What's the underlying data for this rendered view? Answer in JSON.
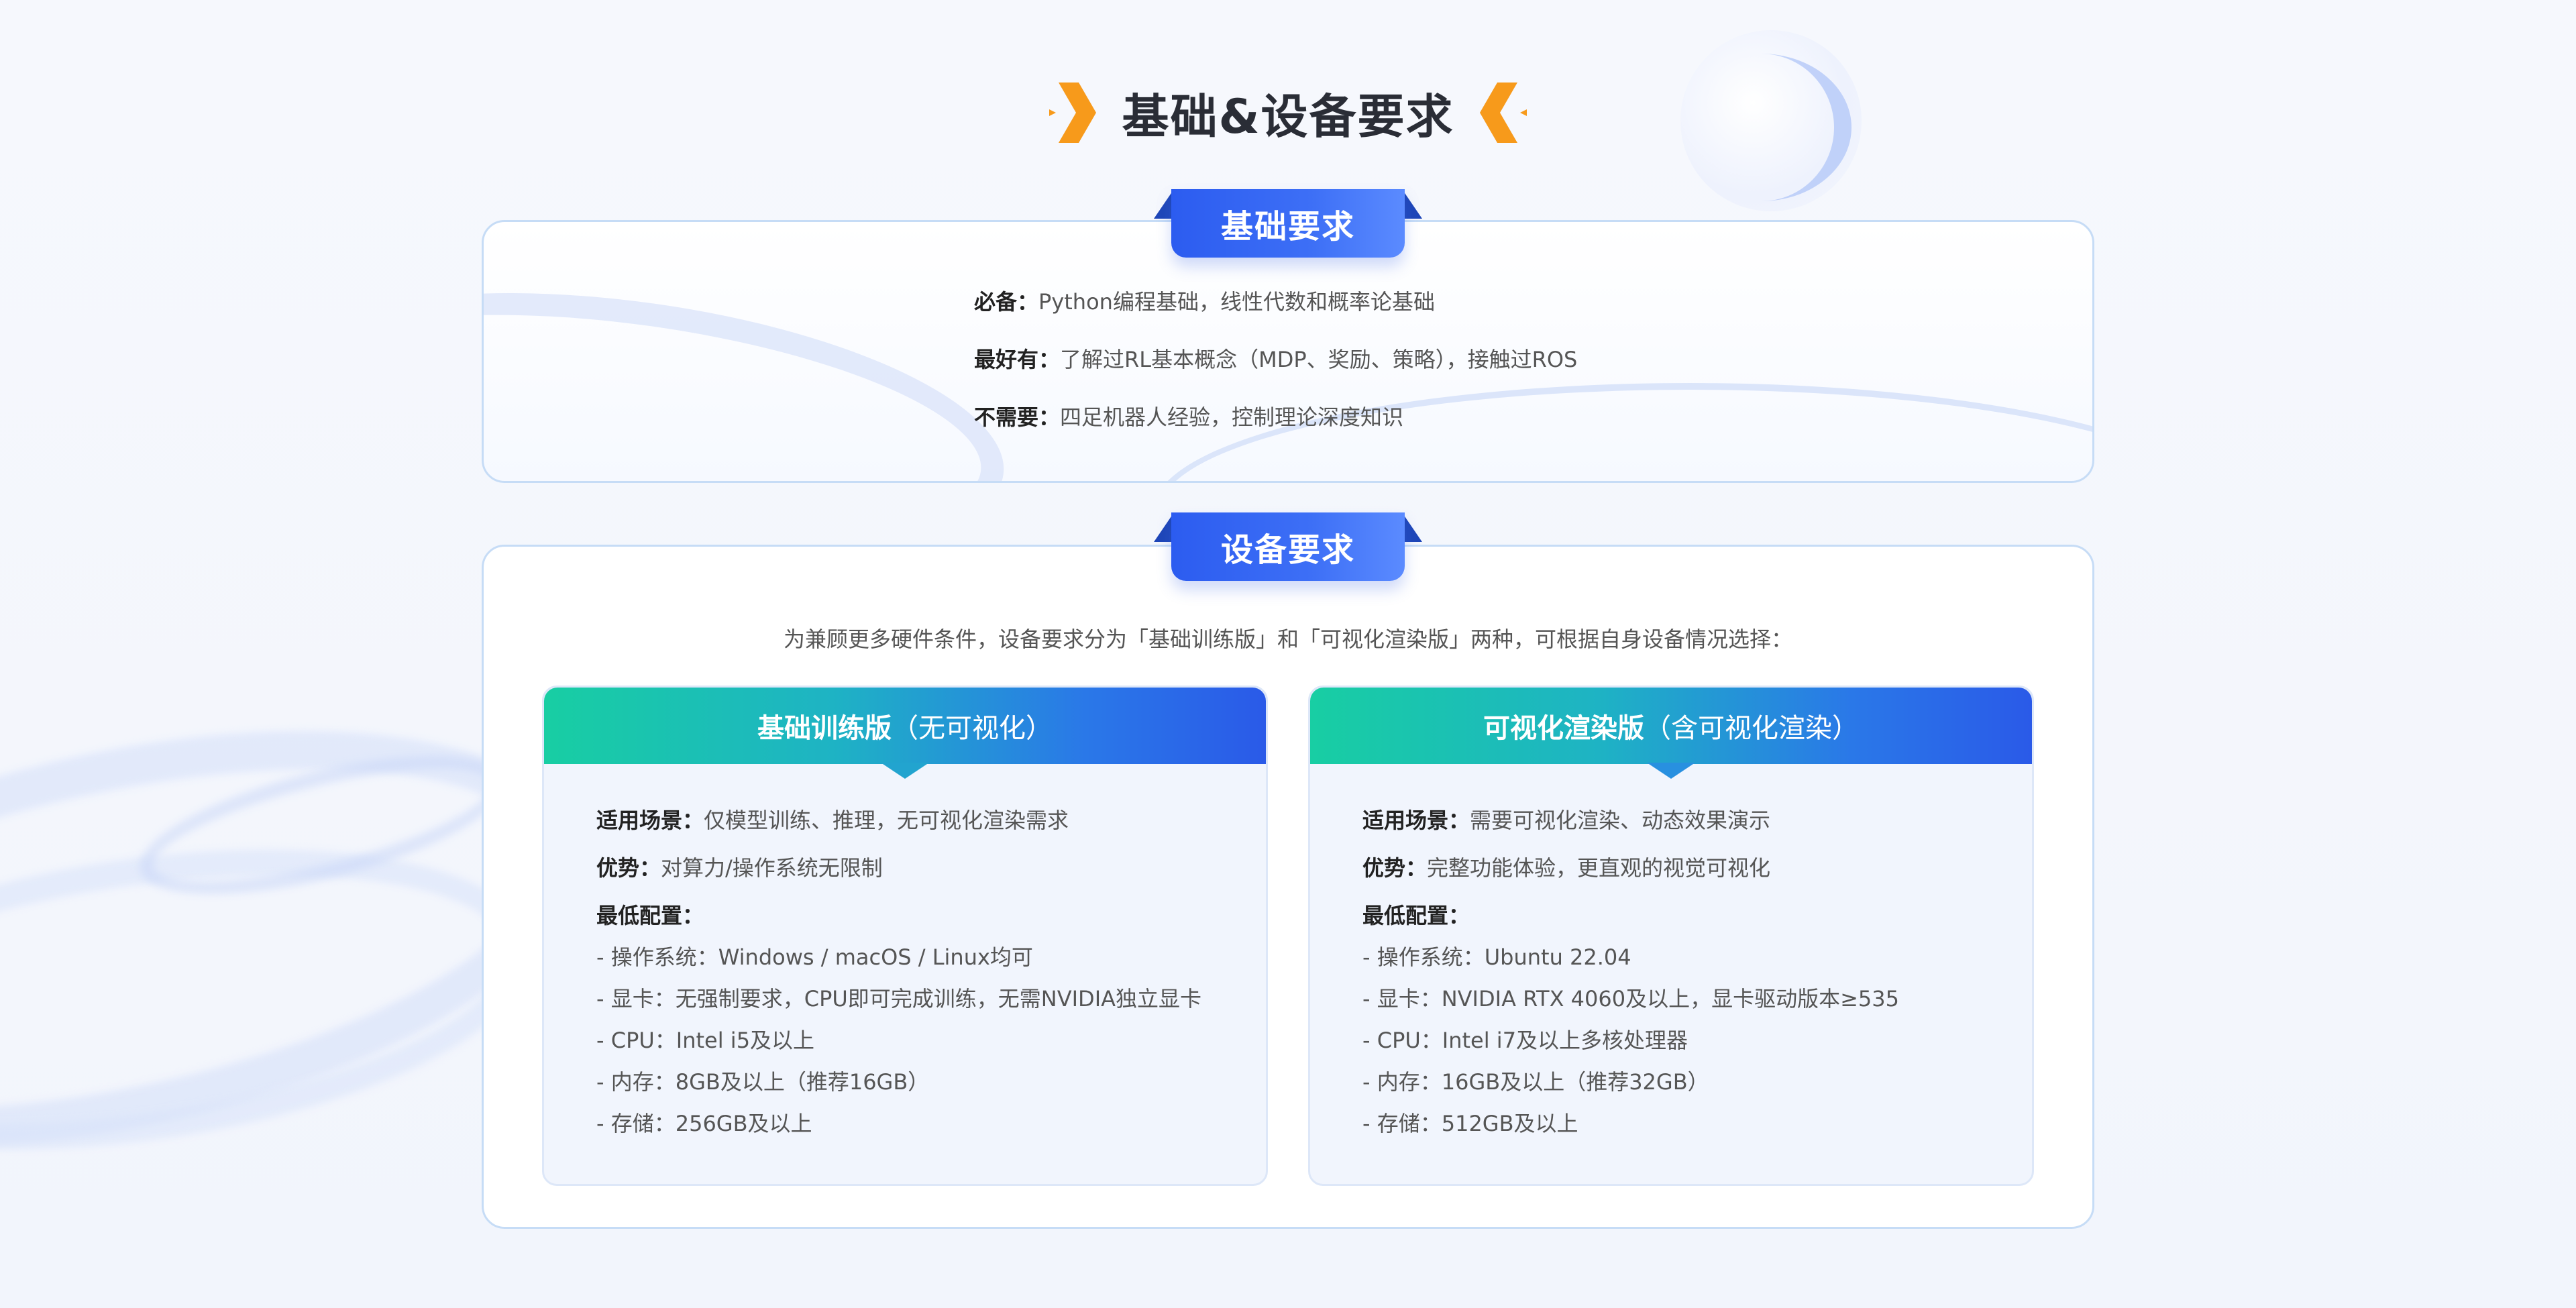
{
  "page": {
    "title": "基础&设备要求",
    "accent_orange": "#f79a1b",
    "accent_blue": "#2c5cf0"
  },
  "basic": {
    "tab_label": "基础要求",
    "lines": [
      {
        "key": "必备：",
        "value": "Python编程基础，线性代数和概率论基础"
      },
      {
        "key": "最好有：",
        "value": "了解过RL基本概念（MDP、奖励、策略），接触过ROS"
      },
      {
        "key": "不需要：",
        "value": "四足机器人经验，控制理论深度知识"
      }
    ]
  },
  "equipment": {
    "tab_label": "设备要求",
    "intro": "为兼顾更多硬件条件，设备要求分为「基础训练版」和「可视化渲染版」两种，可根据自身设备情况选择：",
    "versions": [
      {
        "name": "基础训练版",
        "note": "（无可视化）",
        "scene_key": "适用场景：",
        "scene": "仅模型训练、推理，无可视化渲染需求",
        "adv_key": "优势：",
        "adv": "对算力/操作系统无限制",
        "config_title": "最低配置：",
        "config": [
          "- 操作系统：Windows / macOS / Linux均可",
          "- 显卡：无强制要求，CPU即可完成训练，无需NVIDIA独立显卡",
          "- CPU：Intel i5及以上",
          "- 内存：8GB及以上（推荐16GB）",
          "- 存储：256GB及以上"
        ]
      },
      {
        "name": "可视化渲染版",
        "note": "（含可视化渲染）",
        "scene_key": "适用场景：",
        "scene": "需要可视化渲染、动态效果演示",
        "adv_key": "优势：",
        "adv": "完整功能体验，更直观的视觉可视化",
        "config_title": "最低配置：",
        "config": [
          "- 操作系统：Ubuntu 22.04",
          "- 显卡：NVIDIA RTX 4060及以上，显卡驱动版本≥535",
          "- CPU：Intel i7及以上多核处理器",
          "- 内存：16GB及以上（推荐32GB）",
          "- 存储：512GB及以上"
        ]
      }
    ]
  }
}
